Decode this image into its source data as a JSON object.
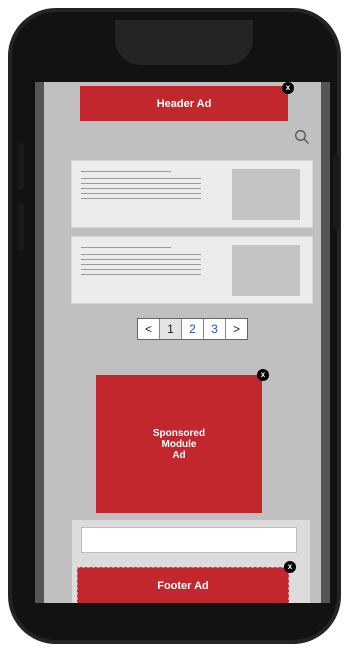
{
  "header_ad": {
    "label": "Header Ad",
    "close": "x"
  },
  "search": {
    "icon": "search-icon"
  },
  "articles": [
    {
      "icon": "image-placeholder"
    },
    {
      "icon": "image-placeholder"
    }
  ],
  "pagination": {
    "prev": "<",
    "pages": [
      "1",
      "2",
      "3"
    ],
    "current": "1",
    "next": ">"
  },
  "sponsored_ad": {
    "line1": "Sponsored",
    "line2": "Module",
    "line3": "Ad",
    "close": "x"
  },
  "footer_ad": {
    "label": "Footer Ad",
    "close": "x"
  },
  "colors": {
    "ad_red": "#c1272d",
    "page_gray": "#c0c0c0",
    "link_blue": "#2255cc"
  }
}
